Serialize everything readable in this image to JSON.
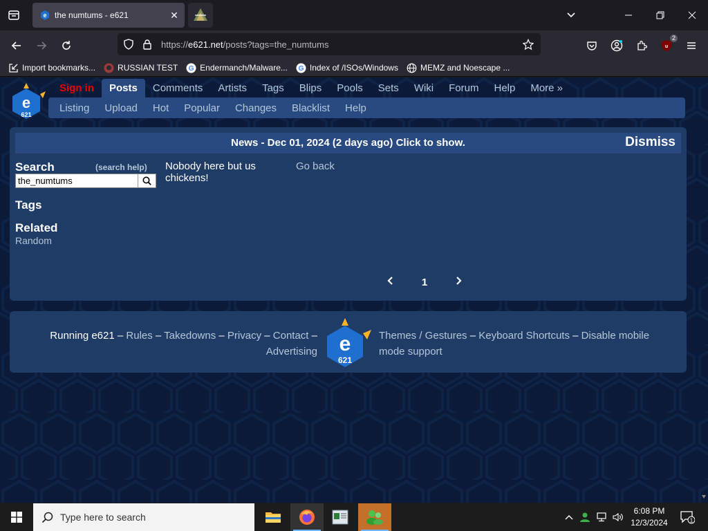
{
  "browser": {
    "active_tab_title": "the numtums - e621",
    "url_prefix": "https://",
    "url_host": "e621.net",
    "url_path": "/posts?tags=the_numtums",
    "extension_badge": "2",
    "bookmarks": [
      {
        "label": "Import bookmarks...",
        "icon": "import-icon"
      },
      {
        "label": "RUSSIAN TEST",
        "icon": "github-icon"
      },
      {
        "label": "Endermanch/Malware...",
        "icon": "google-icon"
      },
      {
        "label": "Index of /ISOs/Windows",
        "icon": "google-icon"
      },
      {
        "label": "MEMZ and Noescape ...",
        "icon": "globe-icon"
      }
    ]
  },
  "site": {
    "main_nav": {
      "sign_in": "Sign in",
      "items": [
        "Posts",
        "Comments",
        "Artists",
        "Tags",
        "Blips",
        "Pools",
        "Sets",
        "Wiki",
        "Forum",
        "Help",
        "More »"
      ]
    },
    "sub_nav": [
      "Listing",
      "Upload",
      "Hot",
      "Popular",
      "Changes",
      "Blacklist",
      "Help"
    ],
    "news": {
      "text": "News - Dec 01, 2024 (2 days ago) Click to show.",
      "dismiss": "Dismiss"
    },
    "sidebar": {
      "search_heading": "Search",
      "search_help": "(search help)",
      "search_value": "the_numtums",
      "tags_heading": "Tags",
      "related_heading": "Related",
      "random_link": "Random"
    },
    "results": {
      "empty_message": "Nobody here but us chickens!",
      "go_back": "Go back"
    },
    "pager": {
      "current_page": "1"
    },
    "footer": {
      "running": "Running e621",
      "left_links": [
        "Rules",
        "Takedowns",
        "Privacy",
        "Contact",
        "Advertising"
      ],
      "right_links": [
        "Themes / Gestures",
        "Keyboard Shortcuts",
        "Disable mobile mode support"
      ]
    },
    "colors": {
      "background": "#0b1a38",
      "panel": "#1f3c67",
      "accent": "#284a81",
      "link": "#b4c7d9",
      "sign_in": "#ee0000"
    }
  },
  "taskbar": {
    "search_placeholder": "Type here to search",
    "time": "6:08 PM",
    "date": "12/3/2024",
    "notification_count": "1"
  }
}
